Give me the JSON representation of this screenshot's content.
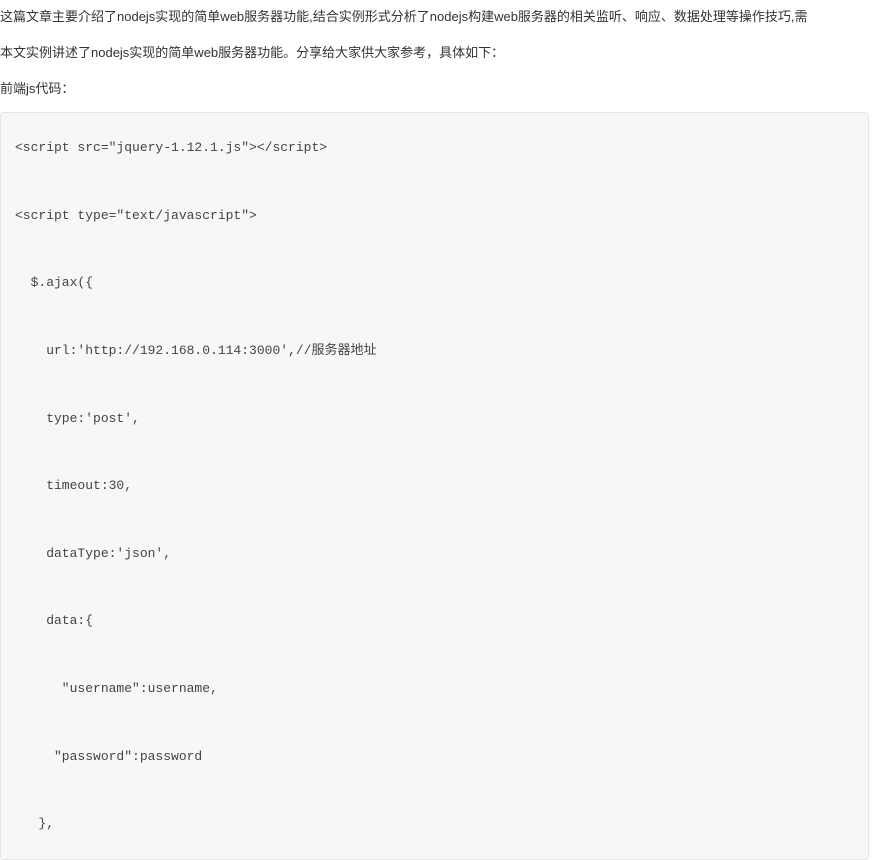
{
  "intro": "这篇文章主要介绍了nodejs实现的简单web服务器功能,结合实例形式分析了nodejs构建web服务器的相关监听、响应、数据处理等操作技巧,需",
  "desc": "本文实例讲述了nodejs实现的简单web服务器功能。分享给大家供大家参考，具体如下：",
  "label": "前端js代码：",
  "code": {
    "line1": "<script src=\"jquery-1.12.1.js\"></script>",
    "line2": "<script type=\"text/javascript\">",
    "line3": "  $.ajax({",
    "line4": "    url:'http://192.168.0.114:3000',//服务器地址",
    "line5": "    type:'post',",
    "line6": "    timeout:30,",
    "line7": "    dataType:'json',",
    "line8": "    data:{",
    "line9": "      \"username\":username,",
    "line10": "     \"password\":password",
    "line11": "   },"
  }
}
